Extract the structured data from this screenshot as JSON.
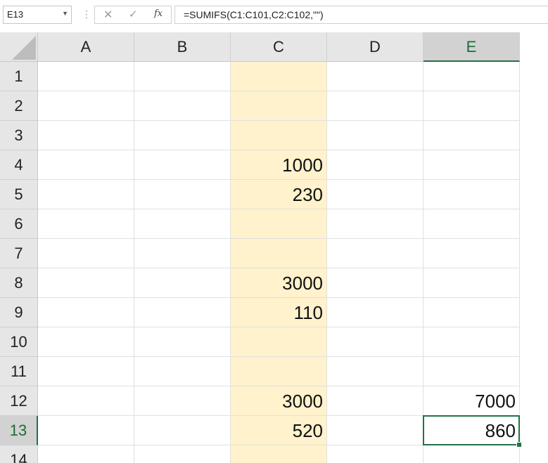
{
  "name_box": {
    "value": "E13"
  },
  "formula_bar": {
    "formula": "=SUMIFS(C1:C101,C2:C102,\"\")",
    "fx_label": "fx"
  },
  "icons": {
    "name_box_dropdown": "chevron-down-icon",
    "cancel": "close-icon",
    "enter": "check-icon",
    "insert_function": "fx-icon"
  },
  "colors": {
    "shaded_column": "#fff2cc",
    "selection_accent": "#217346",
    "header_bg": "#e6e6e6"
  },
  "grid": {
    "columns": [
      "A",
      "B",
      "C",
      "D",
      "E"
    ],
    "rows": [
      "1",
      "2",
      "3",
      "4",
      "5",
      "6",
      "7",
      "8",
      "9",
      "10",
      "11",
      "12",
      "13",
      "14"
    ],
    "selected_column": "E",
    "selected_row": "13",
    "shaded_column": "C",
    "cells": {
      "C4": "1000",
      "C5": "230",
      "C8": "3000",
      "C9": "110",
      "C12": "3000",
      "C13": "520",
      "E12": "7000",
      "E13": "860"
    }
  }
}
